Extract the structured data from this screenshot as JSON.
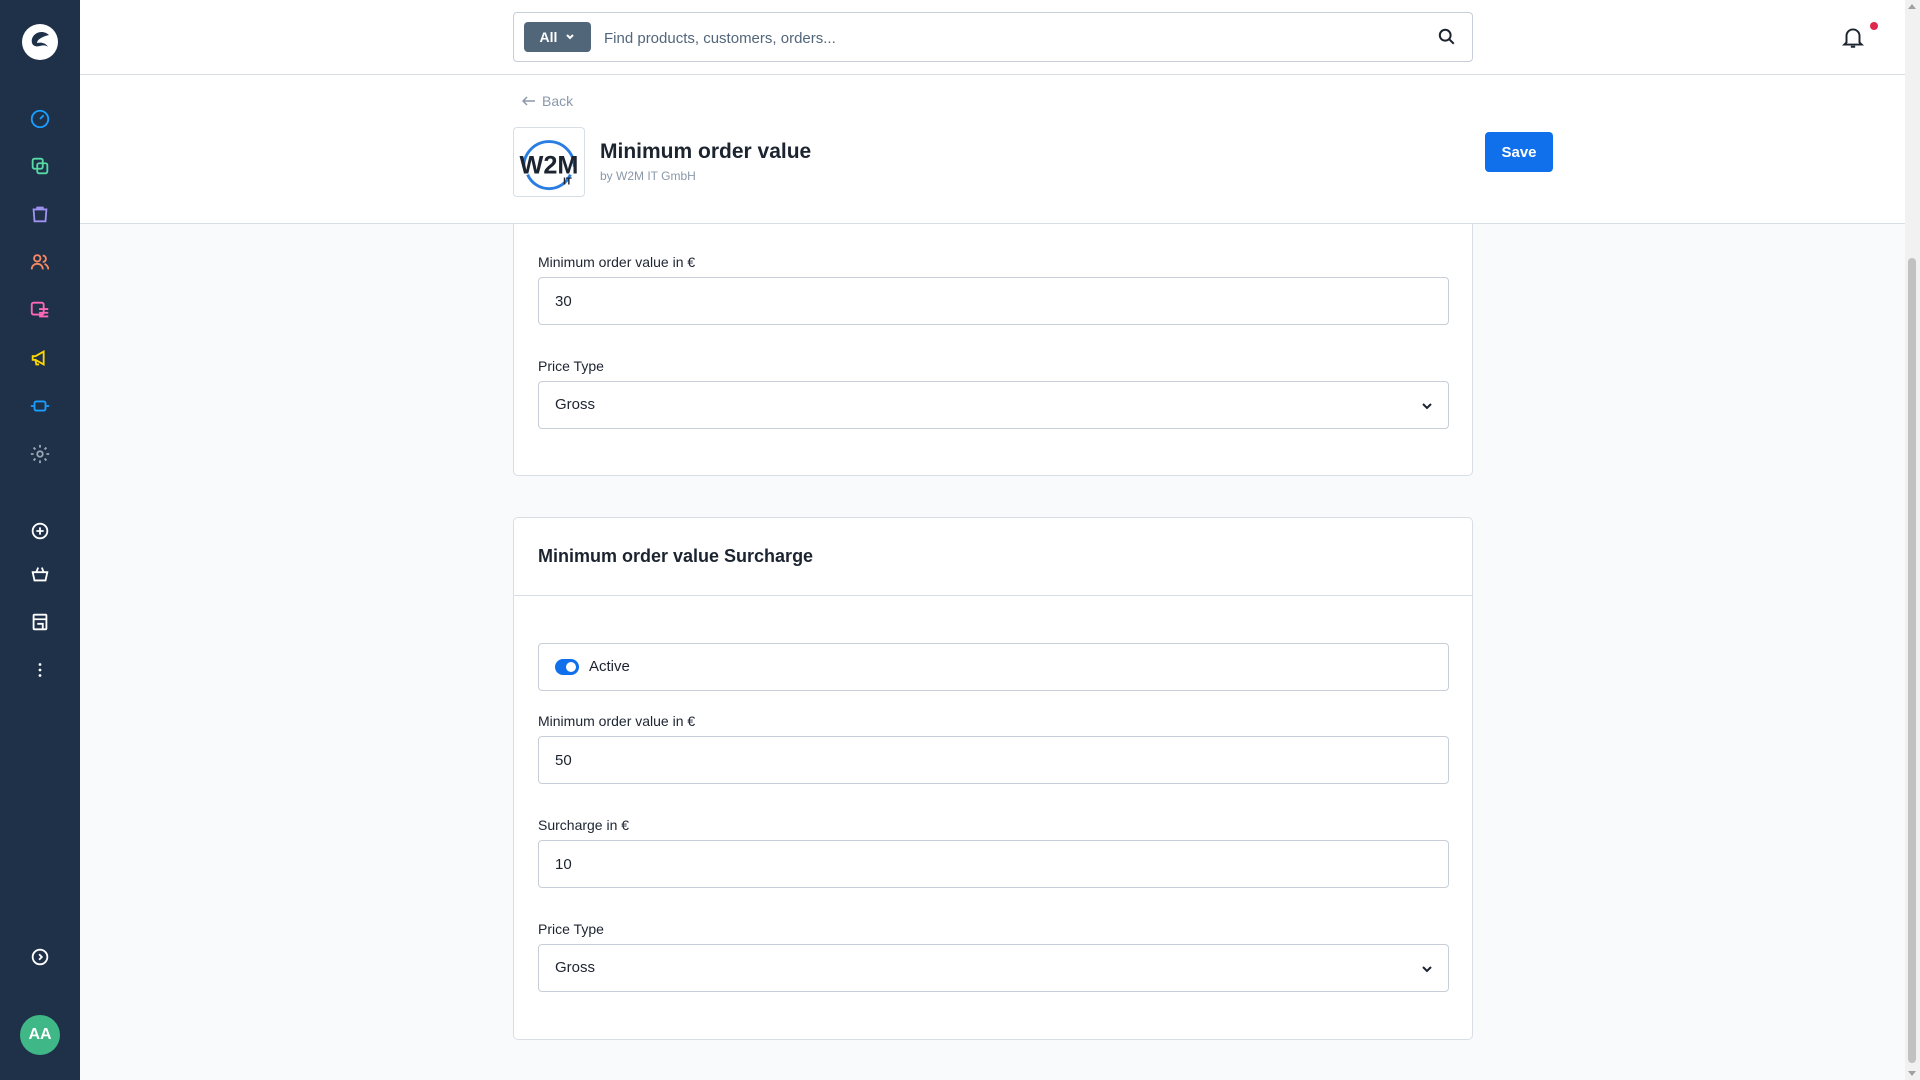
{
  "topbar": {
    "search_type_label": "All",
    "search_placeholder": "Find products, customers, orders..."
  },
  "sidebar": {
    "items": [
      {
        "icon": "dashboard-icon",
        "color": "#189eff"
      },
      {
        "icon": "catalogues-icon",
        "color": "#57d9a3"
      },
      {
        "icon": "orders-icon",
        "color": "#a092f0"
      },
      {
        "icon": "customers-icon",
        "color": "#f88962"
      },
      {
        "icon": "content-icon",
        "color": "#ff68b4"
      },
      {
        "icon": "marketing-icon",
        "color": "#ffd700"
      },
      {
        "icon": "extensions-icon",
        "color": "#189eff"
      },
      {
        "icon": "settings-icon",
        "color": "#9aa8b5"
      },
      {
        "icon": "add-sales-channel-icon",
        "color": "#ffffff"
      },
      {
        "icon": "storefront-icon",
        "color": "#ffffff"
      },
      {
        "icon": "shop-icon",
        "color": "#ffffff"
      },
      {
        "icon": "more-icon",
        "color": "#ffffff"
      },
      {
        "icon": "collapse-icon",
        "color": "#ffffff"
      }
    ],
    "avatar_initials": "AA"
  },
  "header": {
    "back_label": "Back",
    "app_logo_text": "W2M",
    "app_logo_subtext": "IT",
    "title": "Minimum order value",
    "by_line": "by W2M IT GmbH",
    "save_label": "Save"
  },
  "card1": {
    "min_value_label": "Minimum order value in €",
    "min_value": "30",
    "price_type_label": "Price Type",
    "price_type_value": "Gross"
  },
  "card2": {
    "title": "Minimum order value Surcharge",
    "active_label": "Active",
    "active_state": true,
    "min_value_label": "Minimum order value in €",
    "min_value": "50",
    "surcharge_label": "Surcharge in €",
    "surcharge_value": "10",
    "price_type_label": "Price Type",
    "price_type_value": "Gross"
  },
  "colors": {
    "sidebar_bg": "#1f3049",
    "primary": "#1070ec",
    "avatar_bg": "#3fb786"
  }
}
